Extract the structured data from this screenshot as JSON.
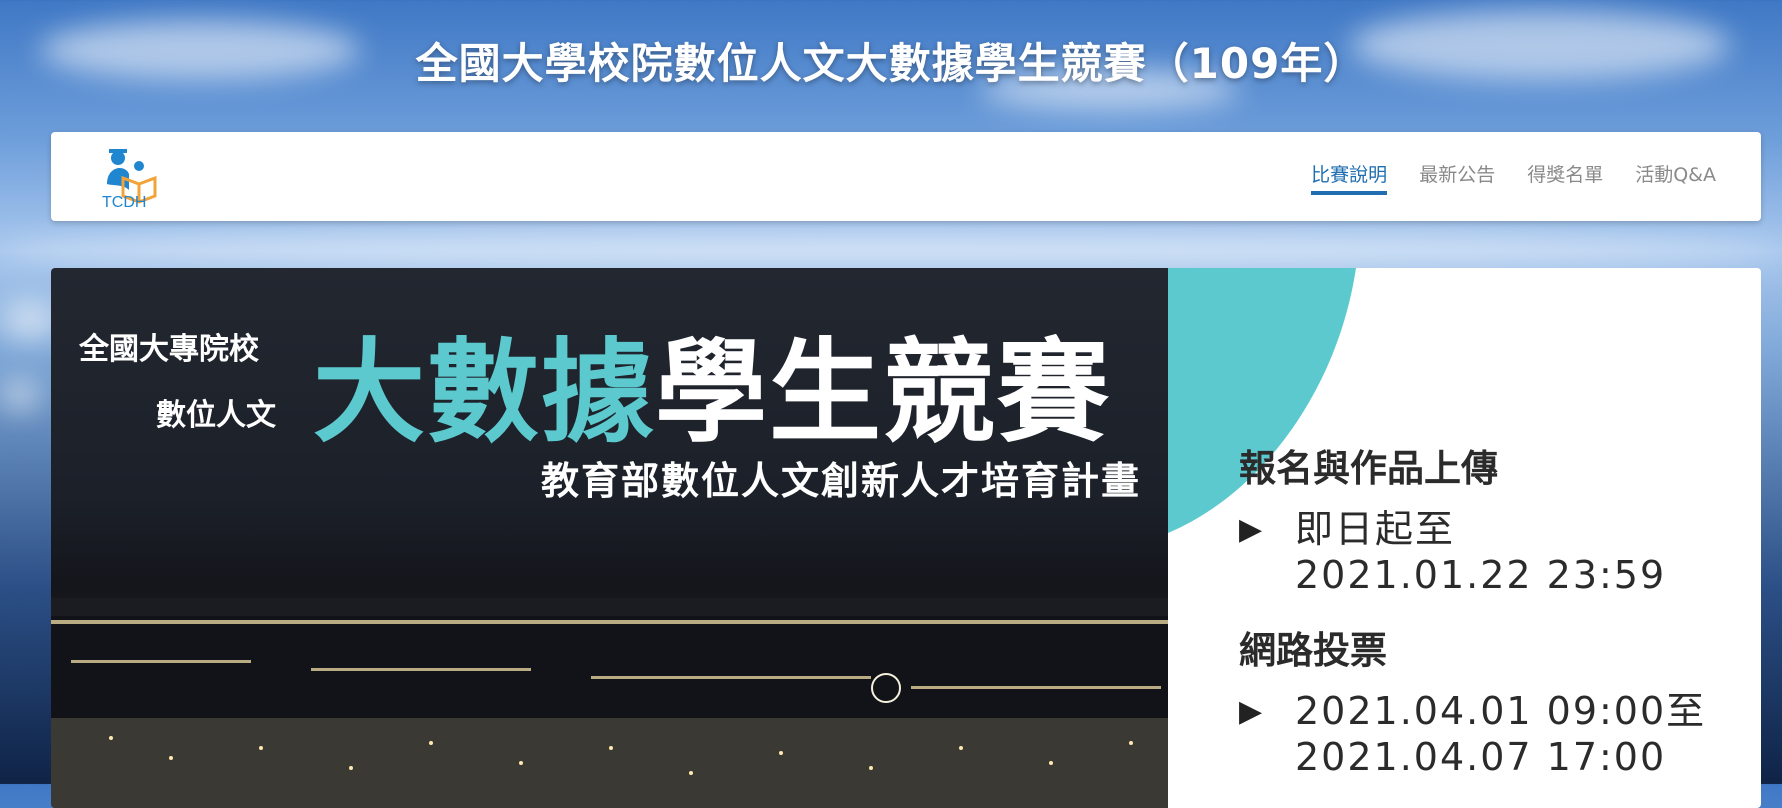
{
  "page": {
    "title": "全國大學校院數位人文大數據學生競賽（109年）"
  },
  "nav": {
    "logo_text": "TCDH",
    "items": [
      {
        "label": "比賽說明",
        "active": true
      },
      {
        "label": "最新公告",
        "active": false
      },
      {
        "label": "得獎名單",
        "active": false
      },
      {
        "label": "活動Q&A",
        "active": false
      }
    ]
  },
  "banner": {
    "sub_line_1": "全國大專院校",
    "sub_line_2": "數位人文",
    "title_teal": "大數據",
    "title_white": "學生競賽",
    "program": "教育部數位人文創新人才培育計畫",
    "registration": {
      "heading": "報名與作品上傳",
      "bullet": "▶",
      "line_1": "即日起至",
      "line_2": "2021.01.22 23:59"
    },
    "voting": {
      "heading": "網路投票",
      "bullet": "▶",
      "line_1": "2021.04.01  09:00至",
      "line_2": "2021.04.07  17:00"
    }
  },
  "colors": {
    "accent_teal": "#5cc9cf",
    "nav_active": "#1f6fb2",
    "nav_inactive": "#8a8a8a",
    "logo_blue": "#1f86cf",
    "logo_orange": "#f2a33a"
  }
}
